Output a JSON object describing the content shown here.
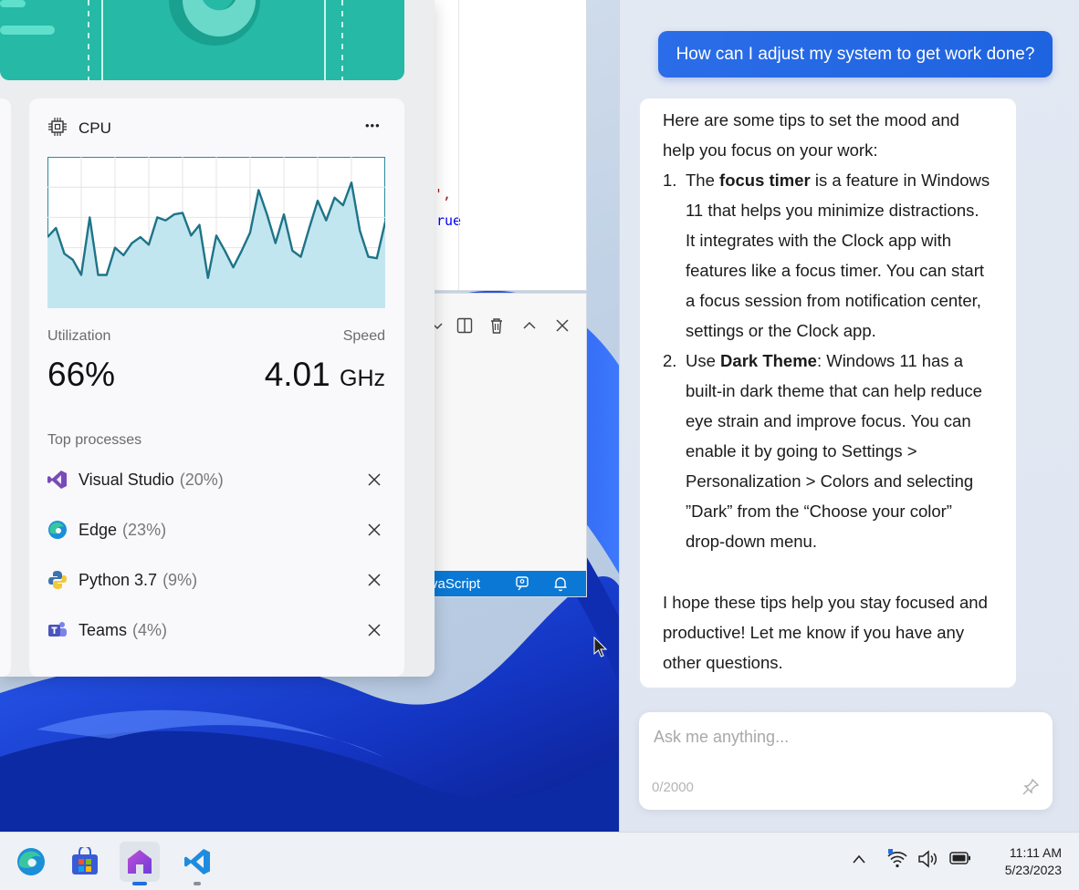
{
  "cpu_widget": {
    "title": "CPU",
    "more_label": "•••",
    "utilization_label": "Utilization",
    "utilization_value": "66%",
    "speed_label": "Speed",
    "speed_value": "4.01",
    "speed_unit": "GHz",
    "top_processes_label": "Top processes",
    "graph_values": [
      47,
      53,
      36,
      32,
      22,
      60,
      22,
      22,
      40,
      35,
      43,
      47,
      42,
      60,
      58,
      62,
      63,
      48,
      55,
      20,
      48,
      38,
      27,
      38,
      50,
      78,
      62,
      43,
      62,
      38,
      34,
      53,
      71,
      58,
      73,
      68,
      83,
      51,
      34,
      33,
      57
    ],
    "processes": [
      {
        "name": "Visual Studio",
        "pct": "(20%)",
        "icon": "visual-studio-icon"
      },
      {
        "name": "Edge",
        "pct": "(23%)",
        "icon": "edge-icon"
      },
      {
        "name": "Python 3.7",
        "pct": "(9%)",
        "icon": "python-icon"
      },
      {
        "name": "Teams",
        "pct": "(4%)",
        "icon": "teams-icon"
      }
    ]
  },
  "editor": {
    "code_line1": "',",
    "code_line2": "rue",
    "status_language": "vaScript"
  },
  "copilot": {
    "user_message": "How can I adjust my system to get work done?",
    "intro_line1": "Here are some tips to set the mood and",
    "intro_line2": "help you focus on your work:",
    "item1_num": "1.",
    "item1_pre": "The ",
    "item1_bold": "focus timer",
    "item1_post": " is a feature in Windows",
    "item1_lines": [
      "11 that helps you minimize distractions.",
      "It integrates with the Clock app with",
      "features like a focus timer. You can start",
      "a focus session from notification center,",
      "settings or the Clock app."
    ],
    "item2_num": "2.",
    "item2_pre": "Use ",
    "item2_bold": "Dark Theme",
    "item2_post": ": Windows 11 has a",
    "item2_lines": [
      "built-in dark theme that can help reduce",
      "eye strain and improve focus. You can",
      "enable it by going to Settings >",
      "Personalization > Colors and selecting",
      "”Dark” from the “Choose your color”",
      "drop-down menu."
    ],
    "closing_lines": [
      "I hope these tips help you stay focused and",
      "productive! Let me know if you have any",
      "other questions."
    ],
    "input_placeholder": "Ask me anything...",
    "char_count": "0/2000"
  },
  "taskbar": {
    "apps": [
      "edge-icon",
      "store-icon",
      "copilot-icon",
      "vscode-icon"
    ],
    "time": "11:11 AM",
    "date": "5/23/2023"
  }
}
